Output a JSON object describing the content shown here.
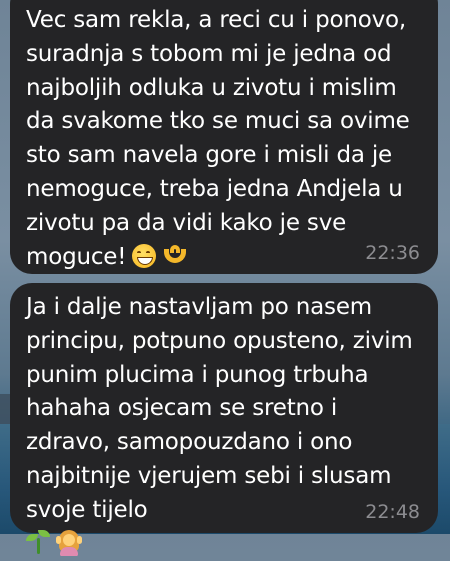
{
  "messages": [
    {
      "text": "Vec sam rekla, a reci cu i ponovo, suradnja s tobom mi je jedna od najboljih odluka u zivotu i mislim da svakome tko se muci sa ovime sto sam navela gore i misli da je nemoguce, treba jedna Andjela u zivotu pa da vidi kako je sve moguce!",
      "emojis": [
        "grinning-face-icon",
        "heart-hands-icon"
      ],
      "time": "22:36"
    },
    {
      "text": "Ja i dalje nastavljam po nasem principu, potpuno opusteno, zivim punim plucima i punog trbuha hahaha osjecam se sretno i zdravo, samopouzdano i ono najbitnije vjerujem sebi i slusam svoje tijelo",
      "emojis": [
        "seedling-icon",
        "person-in-lotus-icon"
      ],
      "time": "22:48"
    }
  ],
  "colors": {
    "bubble": "#242426",
    "text": "#ffffff",
    "timestamp": "#8c8c90"
  }
}
